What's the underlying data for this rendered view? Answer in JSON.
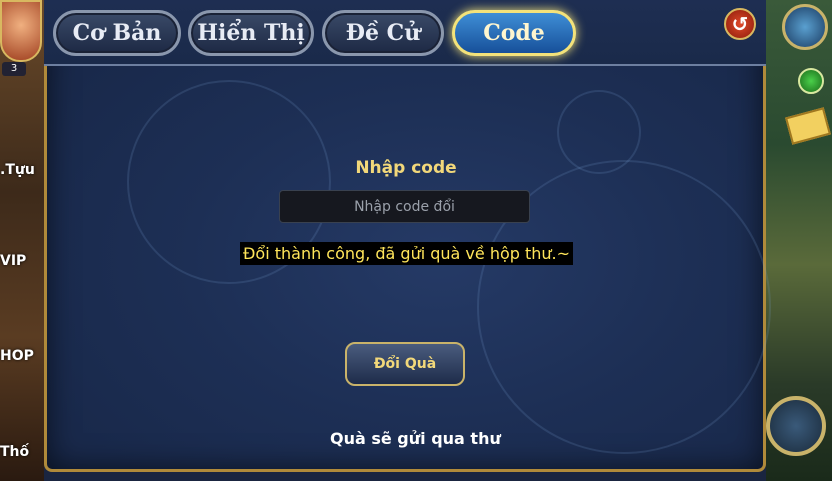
{
  "tabs": [
    {
      "label": "Cơ Bản"
    },
    {
      "label": "Hiển Thị"
    },
    {
      "label": "Đề Cử"
    },
    {
      "label": "Code"
    }
  ],
  "left_menu": {
    "level_badge": "3",
    "items": [
      {
        "label": ".Tựu"
      },
      {
        "label": "VIP"
      },
      {
        "label": "HOP"
      },
      {
        "label": "Thố"
      }
    ]
  },
  "main": {
    "code_label": "Nhập code",
    "code_input": {
      "value": "",
      "placeholder": "Nhập code đổi"
    },
    "success_message": "Đổi thành công, đã gửi quà về hộp thư.~",
    "redeem_button": "Đổi Quà",
    "note": "Quà sẽ gửi qua thư"
  },
  "colors": {
    "active_tab": "#2f7fd0",
    "gold_text": "#f2d87a",
    "success_text": "#ffe55a"
  }
}
